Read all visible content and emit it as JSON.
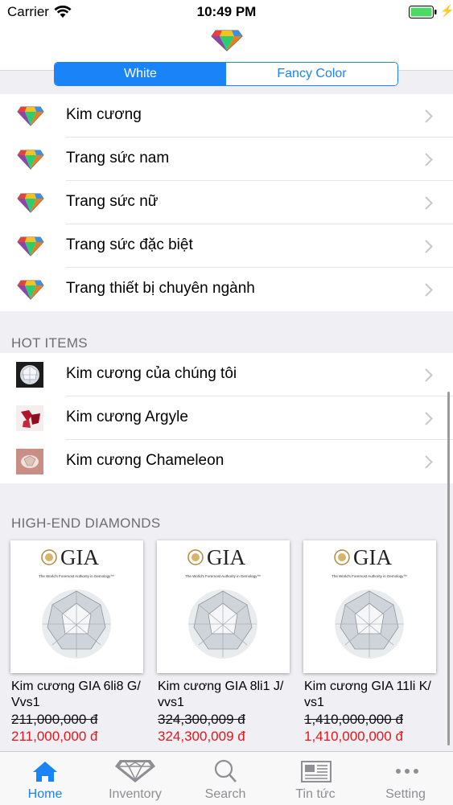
{
  "status_bar": {
    "carrier": "Carrier",
    "time": "10:49 PM"
  },
  "segment": {
    "options": [
      "White",
      "Fancy Color"
    ],
    "selected": 0
  },
  "menu": [
    {
      "label": "Kim cương"
    },
    {
      "label": "Trang sức nam"
    },
    {
      "label": "Trang sức nữ"
    },
    {
      "label": "Trang sức đặc biệt"
    },
    {
      "label": "Trang thiết bị chuyên ngành"
    }
  ],
  "hot_items": {
    "header": "HOT ITEMS",
    "items": [
      {
        "label": "Kim cương của chúng tôi"
      },
      {
        "label": "Kim cương Argyle"
      },
      {
        "label": "Kim cương  Chameleon"
      }
    ]
  },
  "high_end": {
    "header": "HIGH-END DIAMONDS",
    "products": [
      {
        "brand": "GIA",
        "tagline": "The World's Foremost Authority in Gemology™",
        "name": "Kim cương GIA 6li8 G/ Vvs1",
        "old_price": "211,000,000 đ",
        "price": "211,000,000 đ"
      },
      {
        "brand": "GIA",
        "tagline": "The World's Foremost Authority in Gemology™",
        "name": "Kim cương GIA 8li1 J/ vvs1",
        "old_price": "324,300,009 đ",
        "price": "324,300,009 đ"
      },
      {
        "brand": "GIA",
        "tagline": "The World's Foremost Authority in Gemology™",
        "name": "Kim cương GIA 11li K/ vs1",
        "old_price": "1,410,000,000 đ",
        "price": "1,410,000,000 đ"
      }
    ]
  },
  "tabs": [
    {
      "label": "Home",
      "icon": "home-icon",
      "active": true
    },
    {
      "label": "Inventory",
      "icon": "diamond-icon",
      "active": false
    },
    {
      "label": "Search",
      "icon": "search-icon",
      "active": false
    },
    {
      "label": "Tin tức",
      "icon": "newspaper-icon",
      "active": false
    },
    {
      "label": "Setting",
      "icon": "more-icon",
      "active": false
    }
  ],
  "colors": {
    "accent": "#1a83f7",
    "price": "#e3161b"
  }
}
